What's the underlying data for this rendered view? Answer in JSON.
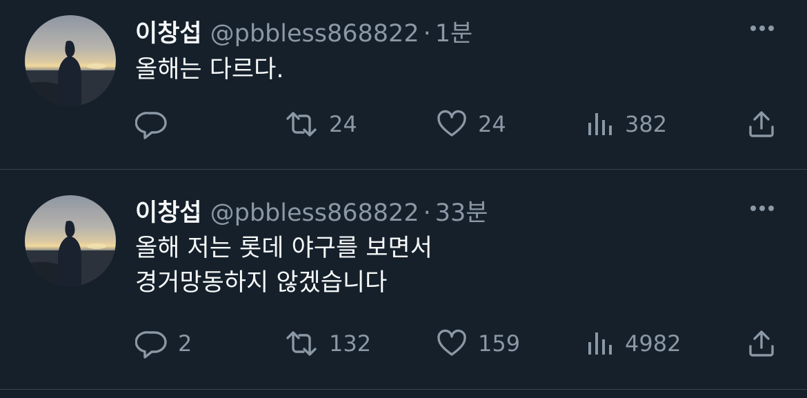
{
  "colors": {
    "background": "#15202b",
    "divider": "#38444d",
    "primary_text": "#f7f9f9",
    "secondary_text": "#8b98a5"
  },
  "tweets": [
    {
      "display_name": "이창섭",
      "handle": "@pbbless868822",
      "separator": "·",
      "time": "1분",
      "text_lines": [
        "올해는 다르다."
      ],
      "actions": {
        "reply_count": "",
        "retweet_count": "24",
        "like_count": "24",
        "view_count": "382"
      },
      "icons": [
        "more-icon",
        "reply-icon",
        "retweet-icon",
        "like-icon",
        "views-icon",
        "share-icon"
      ]
    },
    {
      "display_name": "이창섭",
      "handle": "@pbbless868822",
      "separator": "·",
      "time": "33분",
      "text_lines": [
        "올해 저는 롯데 야구를 보면서",
        "경거망동하지 않겠습니다"
      ],
      "actions": {
        "reply_count": "2",
        "retweet_count": "132",
        "like_count": "159",
        "view_count": "4982"
      },
      "icons": [
        "more-icon",
        "reply-icon",
        "retweet-icon",
        "like-icon",
        "views-icon",
        "share-icon"
      ]
    }
  ]
}
